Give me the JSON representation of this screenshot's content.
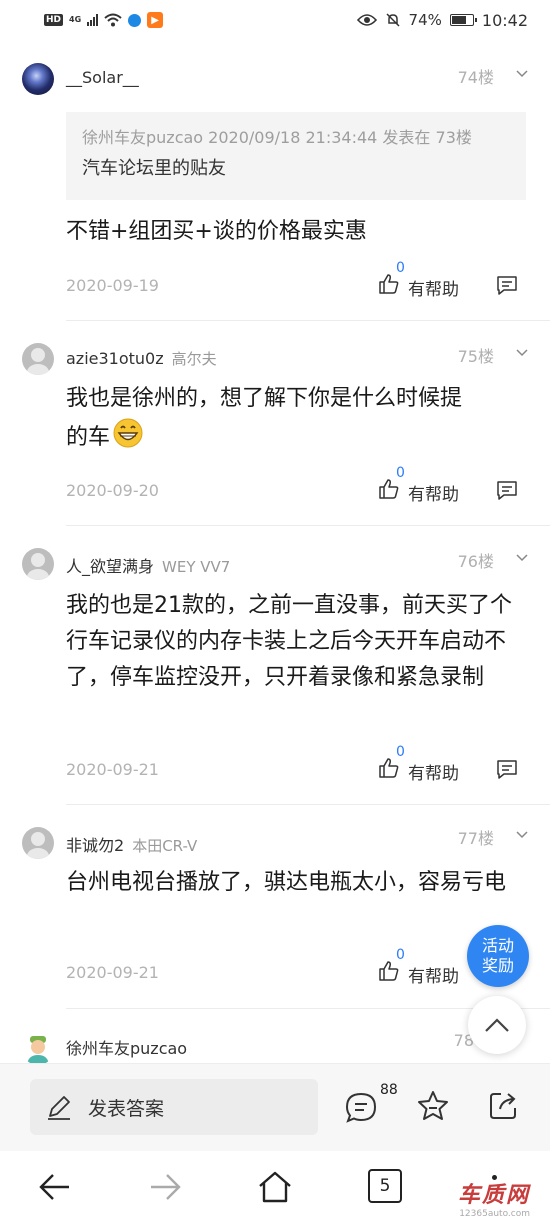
{
  "status_bar": {
    "hd": "HD",
    "network": "4G",
    "battery": "74%",
    "battery_level": 0.74,
    "time": "10:42"
  },
  "posts": [
    {
      "username": "__Solar__",
      "car": "",
      "floor": "74楼",
      "quote": {
        "meta": "徐州车友puzcao 2020/09/18 21:34:44 发表在 73楼",
        "text": "汽车论坛里的贴友"
      },
      "content": "不错+组团买+谈的价格最实惠",
      "date": "2020-09-19",
      "likes": "0",
      "help_label": "有帮助"
    },
    {
      "username": "azie31otu0z",
      "car": "高尔夫",
      "floor": "75楼",
      "content_line1": "我也是徐州的，想了解下你是什么时候提",
      "content_line2": "的车",
      "date": "2020-09-20",
      "likes": "0",
      "help_label": "有帮助"
    },
    {
      "username": "人_欲望满身",
      "car": "WEY VV7",
      "floor": "76楼",
      "content": "我的也是21款的，之前一直没事，前天买了个行车记录仪的内存卡装上之后今天开车启动不了，停车监控没开，只开着录像和紧急录制",
      "date": "2020-09-21",
      "likes": "0",
      "help_label": "有帮助"
    },
    {
      "username": "非诚勿2",
      "car": "本田CR-V",
      "floor": "77楼",
      "content": "台州电视台播放了，骐达电瓶太小，容易亏电",
      "date": "2020-09-21",
      "likes": "0",
      "help_label": "有帮助"
    },
    {
      "username": "徐州车友puzcao",
      "car": "",
      "floor": "78"
    }
  ],
  "floating": {
    "activity_line1": "活动",
    "activity_line2": "奖励"
  },
  "action_bar": {
    "answer_label": "发表答案",
    "comment_count": "88"
  },
  "nav": {
    "tab_count": "5"
  },
  "watermark": {
    "title": "车质网",
    "url": "12365auto.com"
  }
}
